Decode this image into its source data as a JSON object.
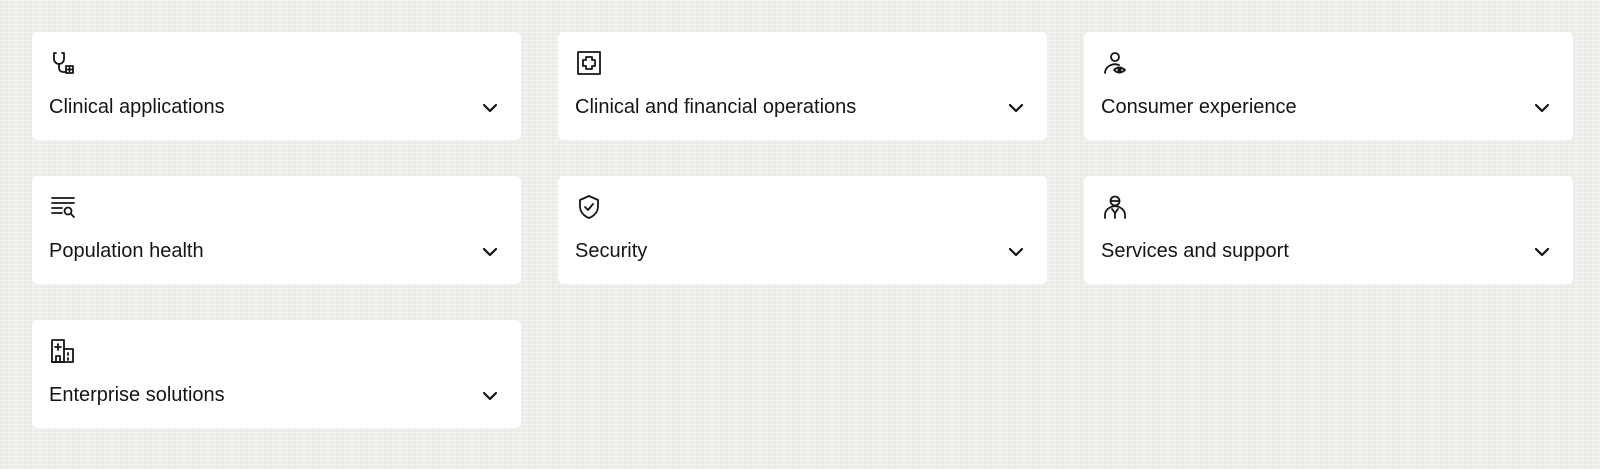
{
  "cards": [
    {
      "label": "Clinical applications",
      "icon": "stethoscope-icon"
    },
    {
      "label": "Clinical and financial operations",
      "icon": "medical-cross-icon"
    },
    {
      "label": "Consumer experience",
      "icon": "person-eye-icon"
    },
    {
      "label": "Population health",
      "icon": "list-search-icon"
    },
    {
      "label": "Security",
      "icon": "shield-check-icon"
    },
    {
      "label": "Services and support",
      "icon": "support-agent-icon"
    },
    {
      "label": "Enterprise solutions",
      "icon": "hospital-building-icon"
    }
  ],
  "colors": {
    "background": "#efedea",
    "card": "#ffffff",
    "text": "#161513"
  }
}
